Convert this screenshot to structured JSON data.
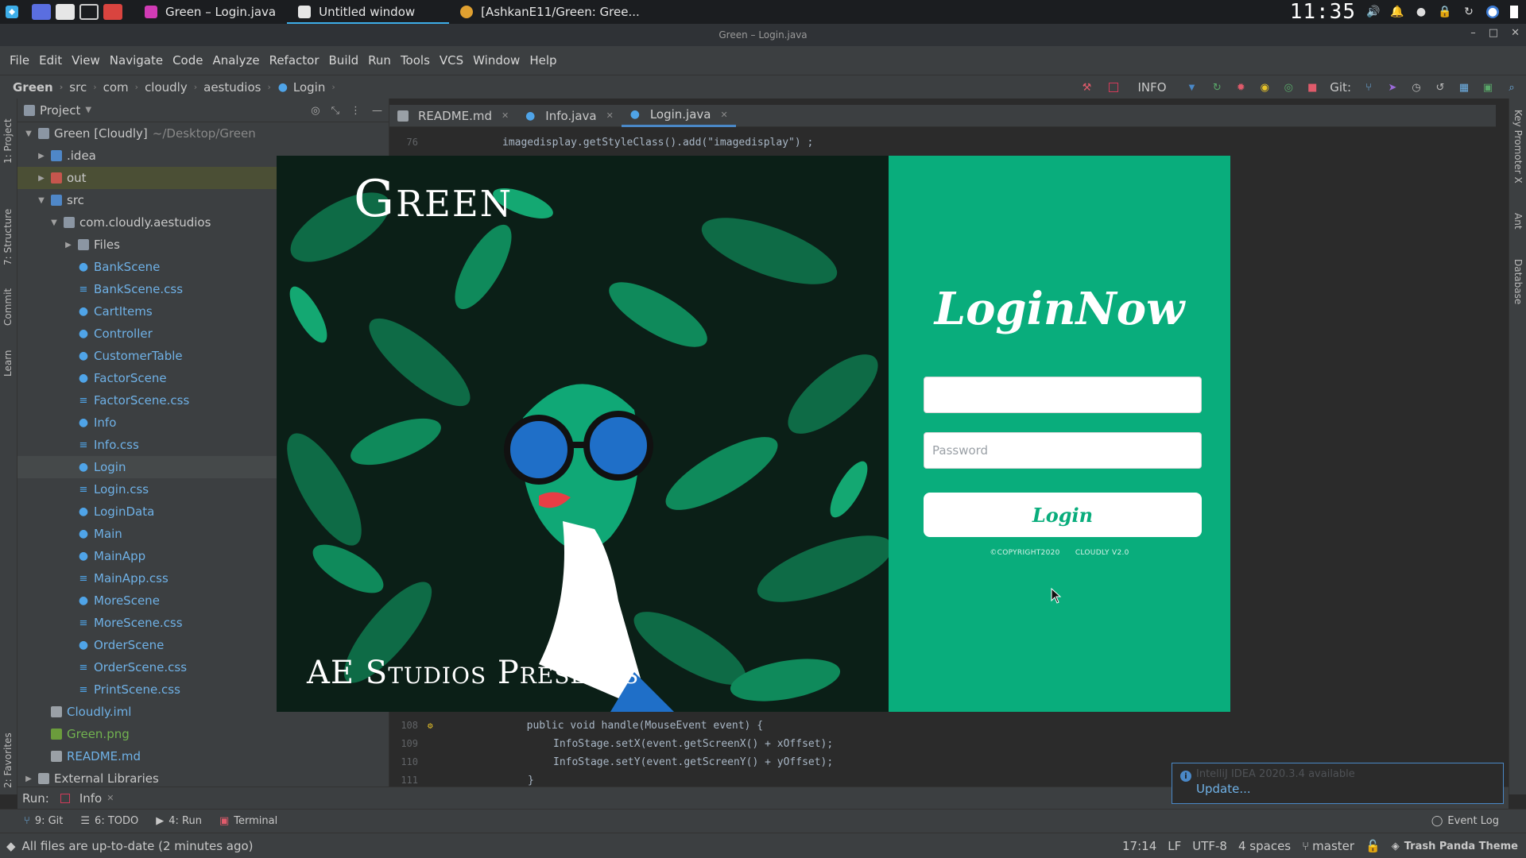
{
  "taskbar": {
    "tasks": [
      {
        "label": "Green – Login.java"
      },
      {
        "label": "Untitled window"
      },
      {
        "label": "[AshkanE11/Green: Gree..."
      }
    ],
    "clock": "11:35"
  },
  "window": {
    "title": "Green – Login.java"
  },
  "menu": [
    "File",
    "Edit",
    "View",
    "Navigate",
    "Code",
    "Analyze",
    "Refactor",
    "Build",
    "Run",
    "Tools",
    "VCS",
    "Window",
    "Help"
  ],
  "breadcrumb": [
    "Green",
    "src",
    "com",
    "cloudly",
    "aestudios",
    "Login"
  ],
  "toolbar": {
    "run_config": "INFO",
    "git_label": "Git:"
  },
  "left_strip": [
    "1: Project",
    "7: Structure",
    "Commit",
    "Learn",
    "2: Favorites"
  ],
  "right_strip": [
    "Key Promoter X",
    "Ant",
    "Database"
  ],
  "project": {
    "header": "Project",
    "tree": [
      {
        "label": "Green [Cloudly]",
        "suffix": "~/Desktop/Green"
      },
      {
        "label": ".idea"
      },
      {
        "label": "out"
      },
      {
        "label": "src"
      },
      {
        "label": "com.cloudly.aestudios"
      },
      {
        "label": "Files"
      },
      {
        "label": "BankScene"
      },
      {
        "label": "BankScene.css"
      },
      {
        "label": "CartItems"
      },
      {
        "label": "Controller"
      },
      {
        "label": "CustomerTable"
      },
      {
        "label": "FactorScene"
      },
      {
        "label": "FactorScene.css"
      },
      {
        "label": "Info"
      },
      {
        "label": "Info.css"
      },
      {
        "label": "Login"
      },
      {
        "label": "Login.css"
      },
      {
        "label": "LoginData"
      },
      {
        "label": "Main"
      },
      {
        "label": "MainApp"
      },
      {
        "label": "MainApp.css"
      },
      {
        "label": "MoreScene"
      },
      {
        "label": "MoreScene.css"
      },
      {
        "label": "OrderScene"
      },
      {
        "label": "OrderScene.css"
      },
      {
        "label": "PrintScene.css"
      },
      {
        "label": "Cloudly.iml"
      },
      {
        "label": "Green.png"
      },
      {
        "label": "README.md"
      },
      {
        "label": "External Libraries"
      }
    ]
  },
  "editor": {
    "tabs": [
      {
        "label": "README.md"
      },
      {
        "label": "Info.java"
      },
      {
        "label": "Login.java"
      }
    ],
    "lines": [
      {
        "num": "76",
        "code": "imagedisplay.getStyleClass().add(\"imagedisplay\") ;"
      },
      {
        "num": "108",
        "code": "public void handle(MouseEvent event) {"
      },
      {
        "num": "109",
        "code": "InfoStage.setX(event.getScreenX() + xOffset);"
      },
      {
        "num": "110",
        "code": "InfoStage.setY(event.getScreenY() + yOffset);"
      },
      {
        "num": "111",
        "code": "}"
      }
    ]
  },
  "splash": {
    "title": "Green",
    "subtitle": "AE Studios Presents",
    "heading": "LoginNow",
    "username_value": "",
    "password_placeholder": "Password",
    "login_label": "Login",
    "copyright": "©COPYRIGHT2020",
    "version": "CLOUDLY V2.0"
  },
  "run_bar": {
    "label": "Run:",
    "tab": "Info"
  },
  "tool_buttons": [
    "9: Git",
    "6: TODO",
    "4: Run",
    "Terminal"
  ],
  "event_log": "Event Log",
  "notification": {
    "title": "IntelliJ IDEA 2020.3.4 available",
    "link": "Update..."
  },
  "status": {
    "message": "All files are up-to-date (2 minutes ago)",
    "position": "17:14",
    "line_sep": "LF",
    "encoding": "UTF-8",
    "indent": "4 spaces",
    "branch": "master",
    "theme": "Trash Panda Theme"
  },
  "colors": {
    "accent": "#09ad7c",
    "ide_bg": "#2b2b2b",
    "panel_bg": "#3c3f41",
    "link": "#6fb1e6"
  }
}
